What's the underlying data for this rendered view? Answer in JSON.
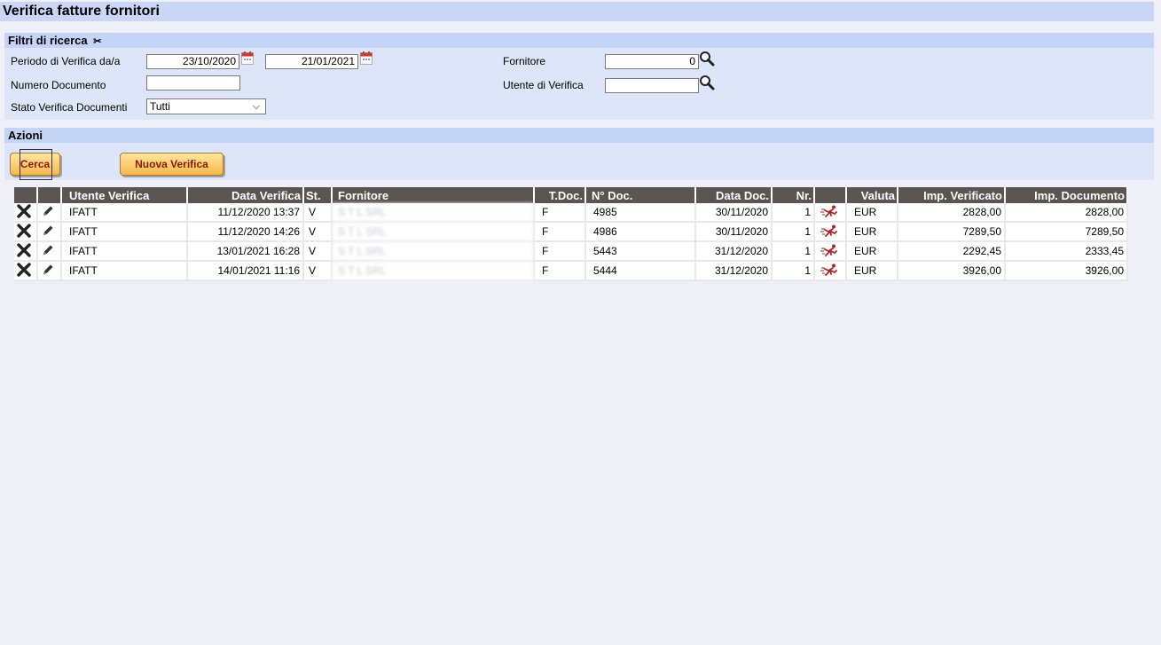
{
  "page": {
    "title": "Verifica fatture fornitori"
  },
  "filters": {
    "header": "Filtri di ricerca",
    "period_label": "Periodo di Verifica da/a",
    "date_from": "23/10/2020",
    "date_to": "21/01/2021",
    "doc_number_label": "Numero Documento",
    "doc_number_value": "",
    "status_label": "Stato Verifica Documenti",
    "status_value": "Tutti",
    "supplier_label": "Fornitore",
    "supplier_value": "0",
    "user_label": "Utente di Verifica",
    "user_value": ""
  },
  "actions": {
    "header": "Azioni",
    "search_label": "Cerca",
    "new_label": "Nuova Verifica"
  },
  "table": {
    "headers": {
      "user": "Utente Verifica",
      "date": "Data Verifica",
      "status": "St.",
      "supplier": "Fornitore",
      "doc_type": "T.Doc.",
      "doc_no": "N° Doc.",
      "doc_date": "Data Doc.",
      "nr": "Nr.",
      "currency": "Valuta",
      "amount_verified": "Imp. Verificato",
      "amount_doc": "Imp. Documento"
    },
    "rows": [
      {
        "user": "IFATT",
        "date": "11/12/2020 13:37",
        "status": "V",
        "supplier": "S T L SRL",
        "doc_type": "F",
        "doc_no": "4985",
        "doc_date": "30/11/2020",
        "nr": "1",
        "currency": "EUR",
        "amount_verified": "2828,00",
        "amount_doc": "2828,00"
      },
      {
        "user": "IFATT",
        "date": "11/12/2020 14:26",
        "status": "V",
        "supplier": "S T L SRL",
        "doc_type": "F",
        "doc_no": "4986",
        "doc_date": "30/11/2020",
        "nr": "1",
        "currency": "EUR",
        "amount_verified": "7289,50",
        "amount_doc": "7289,50"
      },
      {
        "user": "IFATT",
        "date": "13/01/2021 16:28",
        "status": "V",
        "supplier": "S T L SRL",
        "doc_type": "F",
        "doc_no": "5443",
        "doc_date": "31/12/2020",
        "nr": "1",
        "currency": "EUR",
        "amount_verified": "2292,45",
        "amount_doc": "2333,45"
      },
      {
        "user": "IFATT",
        "date": "14/01/2021 11:16",
        "status": "V",
        "supplier": "S T L SRL",
        "doc_type": "F",
        "doc_no": "5444",
        "doc_date": "31/12/2020",
        "nr": "1",
        "currency": "EUR",
        "amount_verified": "3926,00",
        "amount_doc": "3926,00"
      }
    ]
  }
}
